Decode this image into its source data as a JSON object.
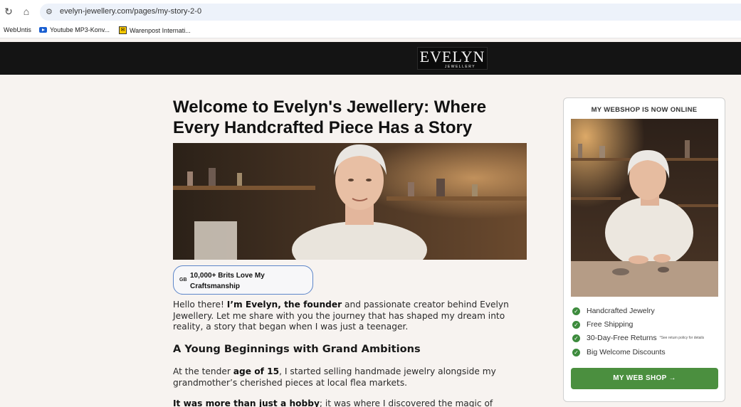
{
  "browser": {
    "url": "evelyn-jewellery.com/pages/my-story-2-0",
    "bookmarks": [
      {
        "label": "WebUntis"
      },
      {
        "label": "Youtube MP3-Konv..."
      },
      {
        "label": "Warenpost Internati..."
      }
    ]
  },
  "header": {
    "logo_main": "EVELYN",
    "logo_sub": "JEWELLERY"
  },
  "article": {
    "title": "Welcome to Evelyn's Jewellery: Where Every Handcrafted Piece Has a Story",
    "badge_flag": "GB",
    "badge_text": "10,000+ Brits Love My Craftsmanship",
    "intro_1": "Hello there! ",
    "intro_bold": "I’m Evelyn, the founder",
    "intro_2": " and passionate creator behind Evelyn Jewellery. Let me share with you the journey that has shaped my dream into reality, a story that began when I was just a teenager.",
    "heading_1": "A Young Beginnings with Grand Ambitions",
    "p2_1": "At the tender ",
    "p2_bold": "age of 15",
    "p2_2": ", I started selling handmade jewelry alongside my grandmother’s cherished pieces at local flea markets.",
    "p3_bold": "It was more than just a hobby",
    "p3_2": "; it was where I discovered the magic of connecting with"
  },
  "sidebar": {
    "title": "MY WEBSHOP IS NOW ONLINE",
    "features": [
      {
        "label": "Handcrafted Jewelry",
        "note": ""
      },
      {
        "label": "Free Shipping",
        "note": ""
      },
      {
        "label": "30-Day-Free Returns",
        "note": "*See return policy for details"
      },
      {
        "label": "Big Welcome Discounts",
        "note": ""
      }
    ],
    "cta_label": "MY WEB SHOP →"
  },
  "colors": {
    "header_bg": "#141414",
    "page_bg": "#f7f3f0",
    "cta_green": "#4b8f3f",
    "badge_border": "#5d86c9"
  }
}
